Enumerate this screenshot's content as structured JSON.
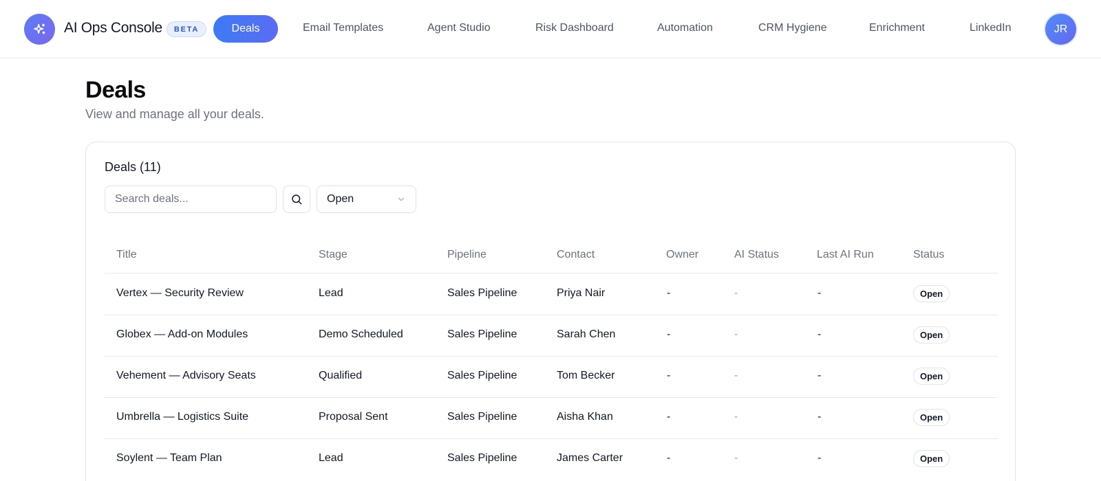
{
  "header": {
    "brand": "AI Ops Console",
    "badge": "BETA",
    "nav": [
      {
        "label": "Deals",
        "active": true
      },
      {
        "label": "Email Templates"
      },
      {
        "label": "Agent Studio"
      },
      {
        "label": "Risk Dashboard"
      },
      {
        "label": "Automation"
      },
      {
        "label": "CRM Hygiene"
      },
      {
        "label": "Enrichment"
      },
      {
        "label": "LinkedIn"
      }
    ],
    "avatar_initials": "JR"
  },
  "page": {
    "title": "Deals",
    "subtitle": "View and manage all your deals."
  },
  "card": {
    "title": "Deals (11)",
    "search_placeholder": "Search deals...",
    "status_filter": "Open"
  },
  "table": {
    "columns": [
      "Title",
      "Stage",
      "Pipeline",
      "Contact",
      "Owner",
      "AI Status",
      "Last AI Run",
      "Status"
    ],
    "rows": [
      {
        "title": "Vertex — Security Review",
        "stage": "Lead",
        "pipeline": "Sales Pipeline",
        "contact": "Priya Nair",
        "owner": "-",
        "ai_status": "-",
        "last_ai_run": "-",
        "status": "Open"
      },
      {
        "title": "Globex — Add-on Modules",
        "stage": "Demo Scheduled",
        "pipeline": "Sales Pipeline",
        "contact": "Sarah Chen",
        "owner": "-",
        "ai_status": "-",
        "last_ai_run": "-",
        "status": "Open"
      },
      {
        "title": "Vehement — Advisory Seats",
        "stage": "Qualified",
        "pipeline": "Sales Pipeline",
        "contact": "Tom Becker",
        "owner": "-",
        "ai_status": "-",
        "last_ai_run": "-",
        "status": "Open"
      },
      {
        "title": "Umbrella — Logistics Suite",
        "stage": "Proposal Sent",
        "pipeline": "Sales Pipeline",
        "contact": "Aisha Khan",
        "owner": "-",
        "ai_status": "-",
        "last_ai_run": "-",
        "status": "Open"
      },
      {
        "title": "Soylent — Team Plan",
        "stage": "Lead",
        "pipeline": "Sales Pipeline",
        "contact": "James Carter",
        "owner": "-",
        "ai_status": "-",
        "last_ai_run": "-",
        "status": "Open"
      }
    ]
  },
  "colors": {
    "accent": "#3d7bf5",
    "accent_end": "#5b6cf4",
    "badge_bg": "#e8efff",
    "border": "#e3e5ea"
  },
  "icons": {
    "logo": "sparkles-icon",
    "search": "search-icon",
    "select": "chevron-down-icon"
  }
}
